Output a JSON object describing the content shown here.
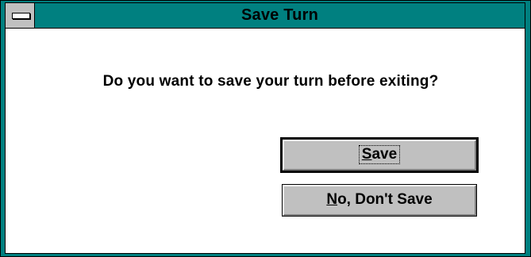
{
  "dialog": {
    "title": "Save Turn",
    "message": "Do you want to save your turn before exiting?"
  },
  "buttons": {
    "save": {
      "mnemonic": "S",
      "rest": "ave",
      "is_default": true,
      "has_focus": true
    },
    "no_save": {
      "mnemonic": "N",
      "rest": "o, Don't Save",
      "is_default": false,
      "has_focus": false
    }
  },
  "icons": {
    "system_menu": "system-menu-icon"
  },
  "colors": {
    "frame": "#008080",
    "titlebar": "#008080",
    "button_face": "#c0c0c0",
    "background": "#ffffff",
    "text": "#000000"
  }
}
